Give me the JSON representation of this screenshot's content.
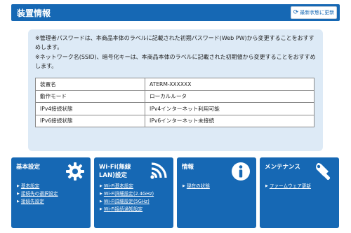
{
  "header": {
    "title": "装置情報",
    "refresh_label": "最新状態に更新"
  },
  "notes": [
    "※管理者パスワードは、本商品本体のラベルに記載された初期パスワード(Web PW)から変更することをおすすめします。",
    "※ネットワーク名(SSID)、暗号化キーは、本商品本体のラベルに記載された初期値から変更することをおすすめします。"
  ],
  "status_table": [
    {
      "label": "装置名",
      "value": "ATERM-XXXXXX"
    },
    {
      "label": "動作モード",
      "value": "ローカルルータ"
    },
    {
      "label": "IPv4接続状態",
      "value": "IPv4インターネット利用可能"
    },
    {
      "label": "IPv6接続状態",
      "value": "IPv6インターネット未接続"
    }
  ],
  "tiles": [
    {
      "title": "基本設定",
      "icon": "gear-icon",
      "links": [
        "基本設定",
        "接続先の選択設定",
        "接続先設定"
      ]
    },
    {
      "title": "Wi-Fi(無線LAN)設定",
      "icon": "wifi-icon",
      "links": [
        "Wi-Fi基本設定",
        "Wi-Fi詳細設定(2.4GHz)",
        "Wi-Fi詳細設定(5GHz)",
        "Wi-Fi接続通知設定"
      ]
    },
    {
      "title": "情報",
      "icon": "info-icon",
      "links": [
        "現在の状態"
      ]
    },
    {
      "title": "メンテナンス",
      "icon": "wrench-icon",
      "links": [
        "ファームウェア更新"
      ]
    }
  ],
  "colors": {
    "accent": "#1668b4",
    "panel": "#ddeaf6"
  }
}
